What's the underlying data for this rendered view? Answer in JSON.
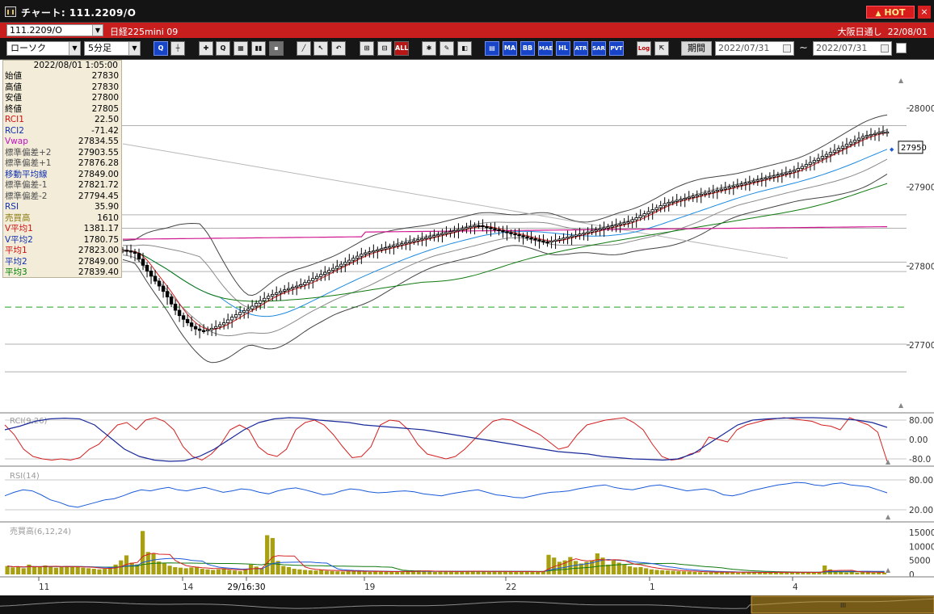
{
  "window": {
    "title": "チャート: 111.2209/O",
    "hot_label": "HOT",
    "close_label": "×"
  },
  "symbol_bar": {
    "code": "111.2209/O",
    "name": "日経225mini 09",
    "session": "大阪日通し",
    "date": "22/08/01"
  },
  "toolbar": {
    "chart_type": "ローソク",
    "interval": "5分足",
    "period_label": "期間",
    "date_from": "2022/07/31",
    "date_separator": "~",
    "date_to": "2022/07/31",
    "indicator_buttons": [
      "MA",
      "BB",
      "MAE",
      "HL",
      "ATR",
      "SAR",
      "PVT"
    ],
    "log_label": "Log",
    "all_label": "ALL"
  },
  "info_panel": {
    "timestamp": "2022/08/01 1:05:00",
    "rows": [
      {
        "label": "始値",
        "value": "27830",
        "color": "#000000"
      },
      {
        "label": "高値",
        "value": "27830",
        "color": "#000000"
      },
      {
        "label": "安値",
        "value": "27800",
        "color": "#000000"
      },
      {
        "label": "終値",
        "value": "27805",
        "color": "#000000"
      },
      {
        "label": "RCI1",
        "value": "22.50",
        "color": "#d01010"
      },
      {
        "label": "RCI2",
        "value": "-71.42",
        "color": "#1030b0"
      },
      {
        "label": "Vwap",
        "value": "27834.55",
        "color": "#c010c0"
      },
      {
        "label": "標準偏差+2",
        "value": "27903.55",
        "color": "#505050"
      },
      {
        "label": "標準偏差+1",
        "value": "27876.28",
        "color": "#505050"
      },
      {
        "label": "移動平均線",
        "value": "27849.00",
        "color": "#1030b0"
      },
      {
        "label": "標準偏差-1",
        "value": "27821.72",
        "color": "#505050"
      },
      {
        "label": "標準偏差-2",
        "value": "27794.45",
        "color": "#505050"
      },
      {
        "label": "RSI",
        "value": "35.90",
        "color": "#1030b0"
      },
      {
        "label": "売買高",
        "value": "1610",
        "color": "#8a7a10"
      },
      {
        "label": "V平均1",
        "value": "1381.17",
        "color": "#d01010"
      },
      {
        "label": "V平均2",
        "value": "1780.75",
        "color": "#1030b0"
      },
      {
        "label": "平均1",
        "value": "27823.00",
        "color": "#d01010"
      },
      {
        "label": "平均2",
        "value": "27849.00",
        "color": "#1030b0"
      },
      {
        "label": "平均3",
        "value": "27839.40",
        "color": "#008000"
      }
    ]
  },
  "chart_data": {
    "type": "candlestick",
    "price_axis_ticks": [
      28000,
      27900,
      27800,
      27700
    ],
    "price_range": [
      27635,
      28018
    ],
    "current_price_label": "27950",
    "x_date_labels": [
      "11",
      "14",
      "29/16:30",
      "19",
      "22",
      "1",
      "4"
    ],
    "bars_count": 190,
    "close_series": [
      27832,
      27835,
      27838,
      27832,
      27828,
      27826,
      27824,
      27820,
      27812,
      27805,
      27800,
      27792,
      27785,
      27780,
      27776,
      27772,
      27768,
      27766,
      27764,
      27762,
      27760,
      27762,
      27764,
      27766,
      27768,
      27770,
      27772,
      27774,
      27776,
      27780,
      27784,
      27788,
      27792,
      27796,
      27800,
      27804,
      27808,
      27812,
      27816,
      27818,
      27820,
      27822,
      27824,
      27826,
      27828,
      27830,
      27832,
      27834,
      27836,
      27838,
      27840,
      27842,
      27844,
      27846,
      27848,
      27850,
      27852,
      27850,
      27848,
      27846,
      27844,
      27842,
      27840,
      27838,
      27836,
      27834,
      27832,
      27830,
      27832,
      27834,
      27836,
      27838,
      27840,
      27842,
      27844,
      27846,
      27848,
      27850,
      27852,
      27854,
      27856,
      27860,
      27864,
      27868,
      27872,
      27876,
      27880,
      27882,
      27884,
      27886,
      27888,
      27890,
      27892,
      27894,
      27896,
      27898,
      27900,
      27902,
      27904,
      27906,
      27908,
      27910,
      27912,
      27914,
      27916,
      27918,
      27920,
      27924,
      27928,
      27932,
      27936,
      27940,
      27944,
      27948,
      27952,
      27956,
      27960,
      27964,
      27966,
      27968,
      27970,
      27970
    ],
    "price_level_lines": [
      27978,
      27865,
      27848,
      27805,
      27793,
      27701,
      27666
    ],
    "dashed_line_price": 27748,
    "rci": {
      "title": "RCI(9,26)",
      "ticks": [
        80,
        0,
        -80
      ],
      "tick_labels": [
        "80.00",
        "0.00",
        "-80.0"
      ],
      "rci1": [
        60,
        20,
        -40,
        -70,
        -80,
        -85,
        -80,
        -85,
        -75,
        -40,
        -20,
        20,
        60,
        70,
        40,
        80,
        90,
        75,
        40,
        -30,
        -70,
        -85,
        -60,
        -20,
        40,
        60,
        40,
        -30,
        -60,
        -70,
        -40,
        40,
        70,
        80,
        60,
        20,
        -30,
        -75,
        -70,
        -30,
        60,
        80,
        75,
        40,
        -20,
        -60,
        -70,
        -80,
        -70,
        -40,
        0,
        40,
        75,
        85,
        80,
        60,
        40,
        20,
        -10,
        -40,
        -30,
        20,
        60,
        70,
        80,
        85,
        90,
        70,
        40,
        -20,
        -70,
        -85,
        -80,
        -60,
        -50,
        10,
        0,
        -10,
        40,
        60,
        70,
        80,
        85,
        90,
        85,
        80,
        75,
        60,
        55,
        40,
        90,
        75,
        60,
        30,
        -90
      ],
      "rci2": [
        40,
        55,
        75,
        85,
        88,
        85,
        60,
        10,
        -40,
        -70,
        -85,
        -90,
        -88,
        -70,
        -40,
        0,
        40,
        70,
        85,
        90,
        88,
        80,
        75,
        70,
        60,
        55,
        50,
        45,
        40,
        30,
        20,
        10,
        0,
        -10,
        -20,
        -30,
        -40,
        -50,
        -55,
        -60,
        -70,
        -75,
        -80,
        -82,
        -85,
        -80,
        -60,
        -20,
        20,
        60,
        80,
        85,
        88,
        90,
        90,
        88,
        85,
        80,
        70,
        50
      ]
    },
    "rsi": {
      "title": "RSI(14)",
      "ticks": [
        80,
        20
      ],
      "tick_labels": [
        "80.00",
        "20.00"
      ],
      "values": [
        48,
        55,
        60,
        58,
        50,
        40,
        35,
        28,
        25,
        30,
        35,
        40,
        42,
        48,
        55,
        60,
        58,
        62,
        65,
        60,
        58,
        62,
        65,
        60,
        55,
        58,
        62,
        60,
        55,
        52,
        58,
        62,
        64,
        60,
        55,
        50,
        52,
        58,
        62,
        60,
        56,
        54,
        55,
        57,
        58,
        56,
        52,
        50,
        48,
        52,
        55,
        58,
        60,
        55,
        50,
        48,
        45,
        44,
        48,
        52,
        55,
        56,
        58,
        62,
        65,
        68,
        70,
        65,
        62,
        60,
        64,
        68,
        70,
        66,
        62,
        58,
        60,
        62,
        58,
        50,
        48,
        52,
        58,
        62,
        66,
        70,
        72,
        75,
        74,
        70,
        68,
        72,
        74,
        70,
        68,
        66,
        60,
        54
      ]
    },
    "volume": {
      "title": "売買高(6,12,24)",
      "ticks": [
        15000,
        10000,
        5000,
        0
      ],
      "tick_labels": [
        "15000",
        "10000",
        "5000",
        "0"
      ],
      "values": [
        3000,
        2500,
        2800,
        2200,
        3500,
        2600,
        2800,
        3200,
        2900,
        2400,
        2700,
        3000,
        2600,
        2800,
        2400,
        2200,
        2000,
        1800,
        2000,
        2500,
        3500,
        5000,
        6800,
        4200,
        3600,
        15500,
        8000,
        7400,
        4600,
        4000,
        3100,
        2600,
        2400,
        2200,
        2500,
        2700,
        2000,
        1800,
        1600,
        1800,
        2200,
        1600,
        1400,
        1200,
        2000,
        3500,
        2800,
        2000,
        14000,
        13000,
        4800,
        3000,
        2600,
        2000,
        1800,
        1600,
        1500,
        1400,
        1600,
        1300,
        1200,
        1100,
        1000,
        1200,
        1300,
        1100,
        1000,
        900,
        1200,
        1100,
        1000,
        900,
        1000,
        1100,
        1200,
        1300,
        1400,
        1200,
        1000,
        900,
        1000,
        1100,
        1200,
        1000,
        1100,
        1200,
        1300,
        1100,
        1000,
        900,
        1000,
        1100,
        1200,
        1000,
        900,
        1000,
        1100,
        1000,
        900,
        1000,
        7000,
        6000,
        4500,
        5000,
        6200,
        4800,
        3900,
        4500,
        5000,
        7500,
        6000,
        3500,
        5000,
        4200,
        3600,
        2900,
        2500,
        2600,
        2200,
        1800,
        1600,
        1500,
        1400,
        1300,
        1200,
        1100,
        1000,
        900,
        800,
        700,
        800,
        900,
        1000,
        800,
        700,
        600,
        700,
        800,
        900,
        700,
        600,
        700,
        800,
        900,
        800,
        700,
        600,
        700,
        800,
        700,
        900,
        3200,
        1800,
        900,
        1100,
        700,
        1200,
        600,
        800,
        700,
        600,
        700,
        600
      ]
    }
  }
}
